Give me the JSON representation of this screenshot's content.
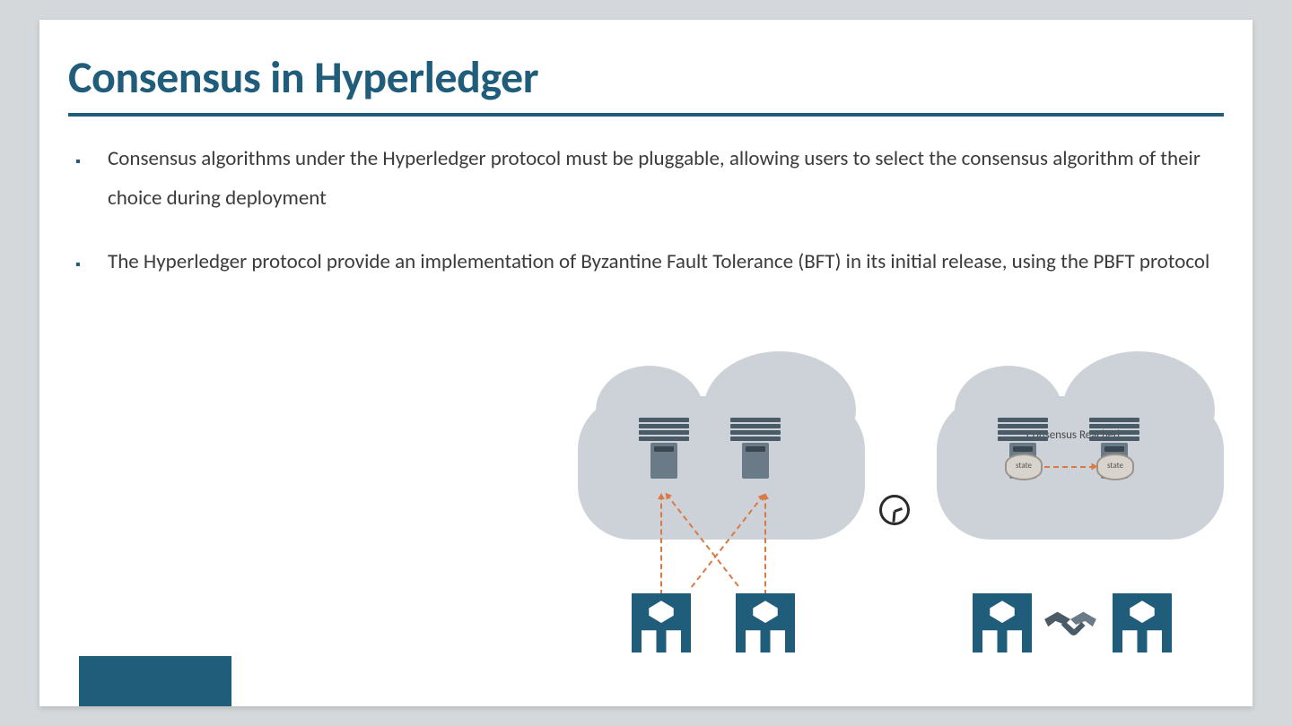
{
  "title": "Consensus in Hyperledger",
  "bullets": [
    "Consensus algorithms under the Hyperledger protocol must be pluggable, allowing users to select the consensus algorithm of their choice during deployment",
    "The Hyperledger protocol provide an implementation of Byzantine Fault Tolerance (BFT) in its initial release, using the PBFT protocol"
  ],
  "diagram": {
    "consensus_label": "Consensus Reached",
    "state_label": "state"
  },
  "colors": {
    "accent": "#1f5d7b",
    "cloud": "#ccd2d8",
    "arrow": "#d97a44"
  }
}
